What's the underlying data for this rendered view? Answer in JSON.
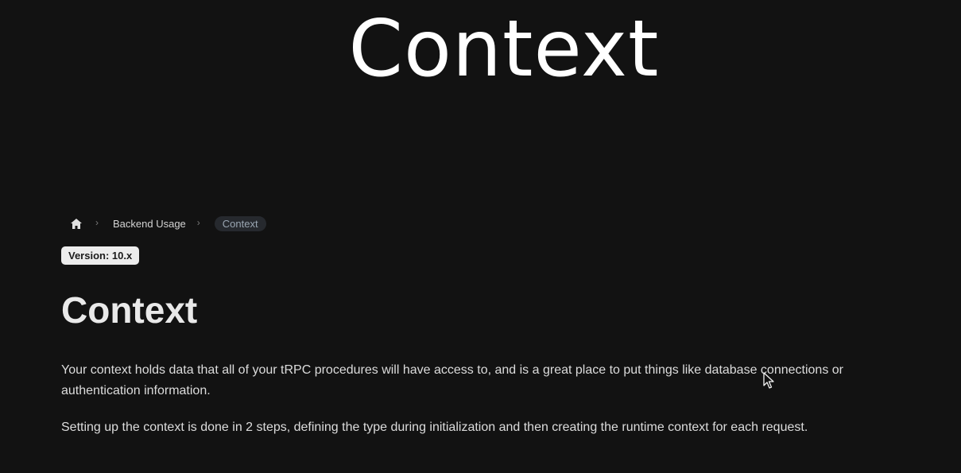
{
  "overlay": {
    "title": "Context"
  },
  "breadcrumb": {
    "home_icon": "home-icon",
    "separator": "›",
    "items": [
      {
        "label": "Backend Usage"
      },
      {
        "label": "Context"
      }
    ]
  },
  "version_badge": "Version: 10.x",
  "page": {
    "title": "Context",
    "paragraphs": [
      "Your context holds data that all of your tRPC procedures will have access to, and is a great place to put things like database connections or authentication information.",
      "Setting up the context is done in 2 steps, defining the type during initialization and then creating the runtime context for each request."
    ]
  },
  "icons": {
    "cursor": "mouse-pointer-icon"
  },
  "colors": {
    "background": "#121212",
    "badge_bg": "#ececec",
    "active_crumb_bg": "#26292e"
  }
}
